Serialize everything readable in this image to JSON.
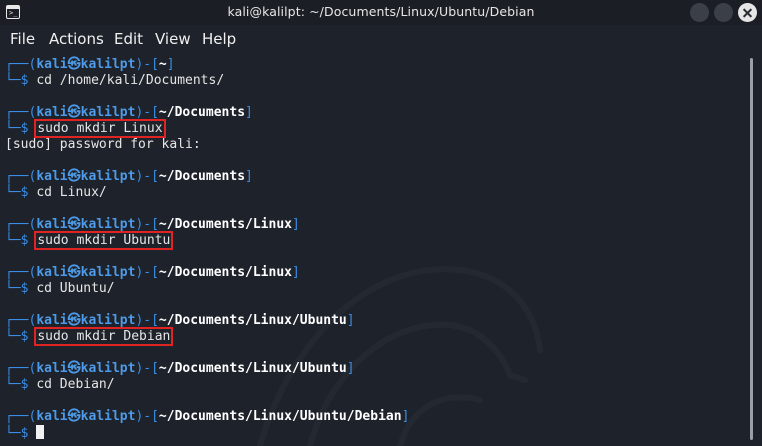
{
  "window": {
    "title": "kali@kalilpt: ~/Documents/Linux/Ubuntu/Debian"
  },
  "menu": [
    "File",
    "Actions",
    "Edit",
    "View",
    "Help"
  ],
  "prompt": {
    "user": "kali",
    "host": "kalilpt",
    "skull": "㉿",
    "dollar": "$"
  },
  "blocks": [
    {
      "cwd": "~",
      "command": "cd /home/kali/Documents/",
      "highlighted": false,
      "output": ""
    },
    {
      "cwd": "~/Documents",
      "command": "sudo mkdir Linux",
      "highlighted": true,
      "output": "[sudo] password for kali:"
    },
    {
      "cwd": "~/Documents",
      "command": "cd Linux/",
      "highlighted": false,
      "output": ""
    },
    {
      "cwd": "~/Documents/Linux",
      "command": "sudo mkdir Ubuntu",
      "highlighted": true,
      "output": ""
    },
    {
      "cwd": "~/Documents/Linux",
      "command": "cd Ubuntu/",
      "highlighted": false,
      "output": ""
    },
    {
      "cwd": "~/Documents/Linux/Ubuntu",
      "command": "sudo mkdir Debian",
      "highlighted": true,
      "output": ""
    },
    {
      "cwd": "~/Documents/Linux/Ubuntu",
      "command": "cd Debian/",
      "highlighted": false,
      "output": ""
    },
    {
      "cwd": "~/Documents/Linux/Ubuntu/Debian",
      "command": "",
      "highlighted": false,
      "output": ""
    }
  ],
  "colors": {
    "prompt_frame": "#3a8ee6",
    "highlight_box": "#e02424",
    "background": "#1e222a"
  }
}
